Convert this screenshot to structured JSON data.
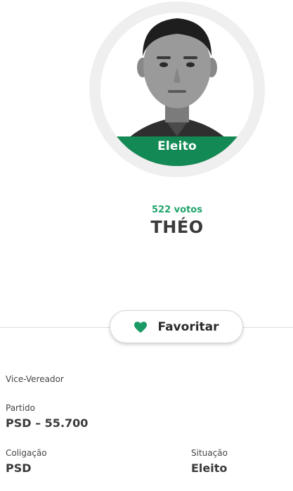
{
  "candidate": {
    "status_badge": "Eleito",
    "votes": "522 votos",
    "name": "THÉO"
  },
  "favorite": {
    "label": "Favoritar",
    "icon": "heart-icon"
  },
  "details": {
    "role": "Vice-Vereador",
    "party_label": "Partido",
    "party_value": "PSD – 55.700",
    "coalition_label": "Coligação",
    "coalition_value": "PSD",
    "situation_label": "Situação",
    "situation_value": "Eleito"
  },
  "colors": {
    "accent_green": "#1a9b66",
    "badge_green": "#138a55",
    "ring_gray": "#efefef"
  }
}
